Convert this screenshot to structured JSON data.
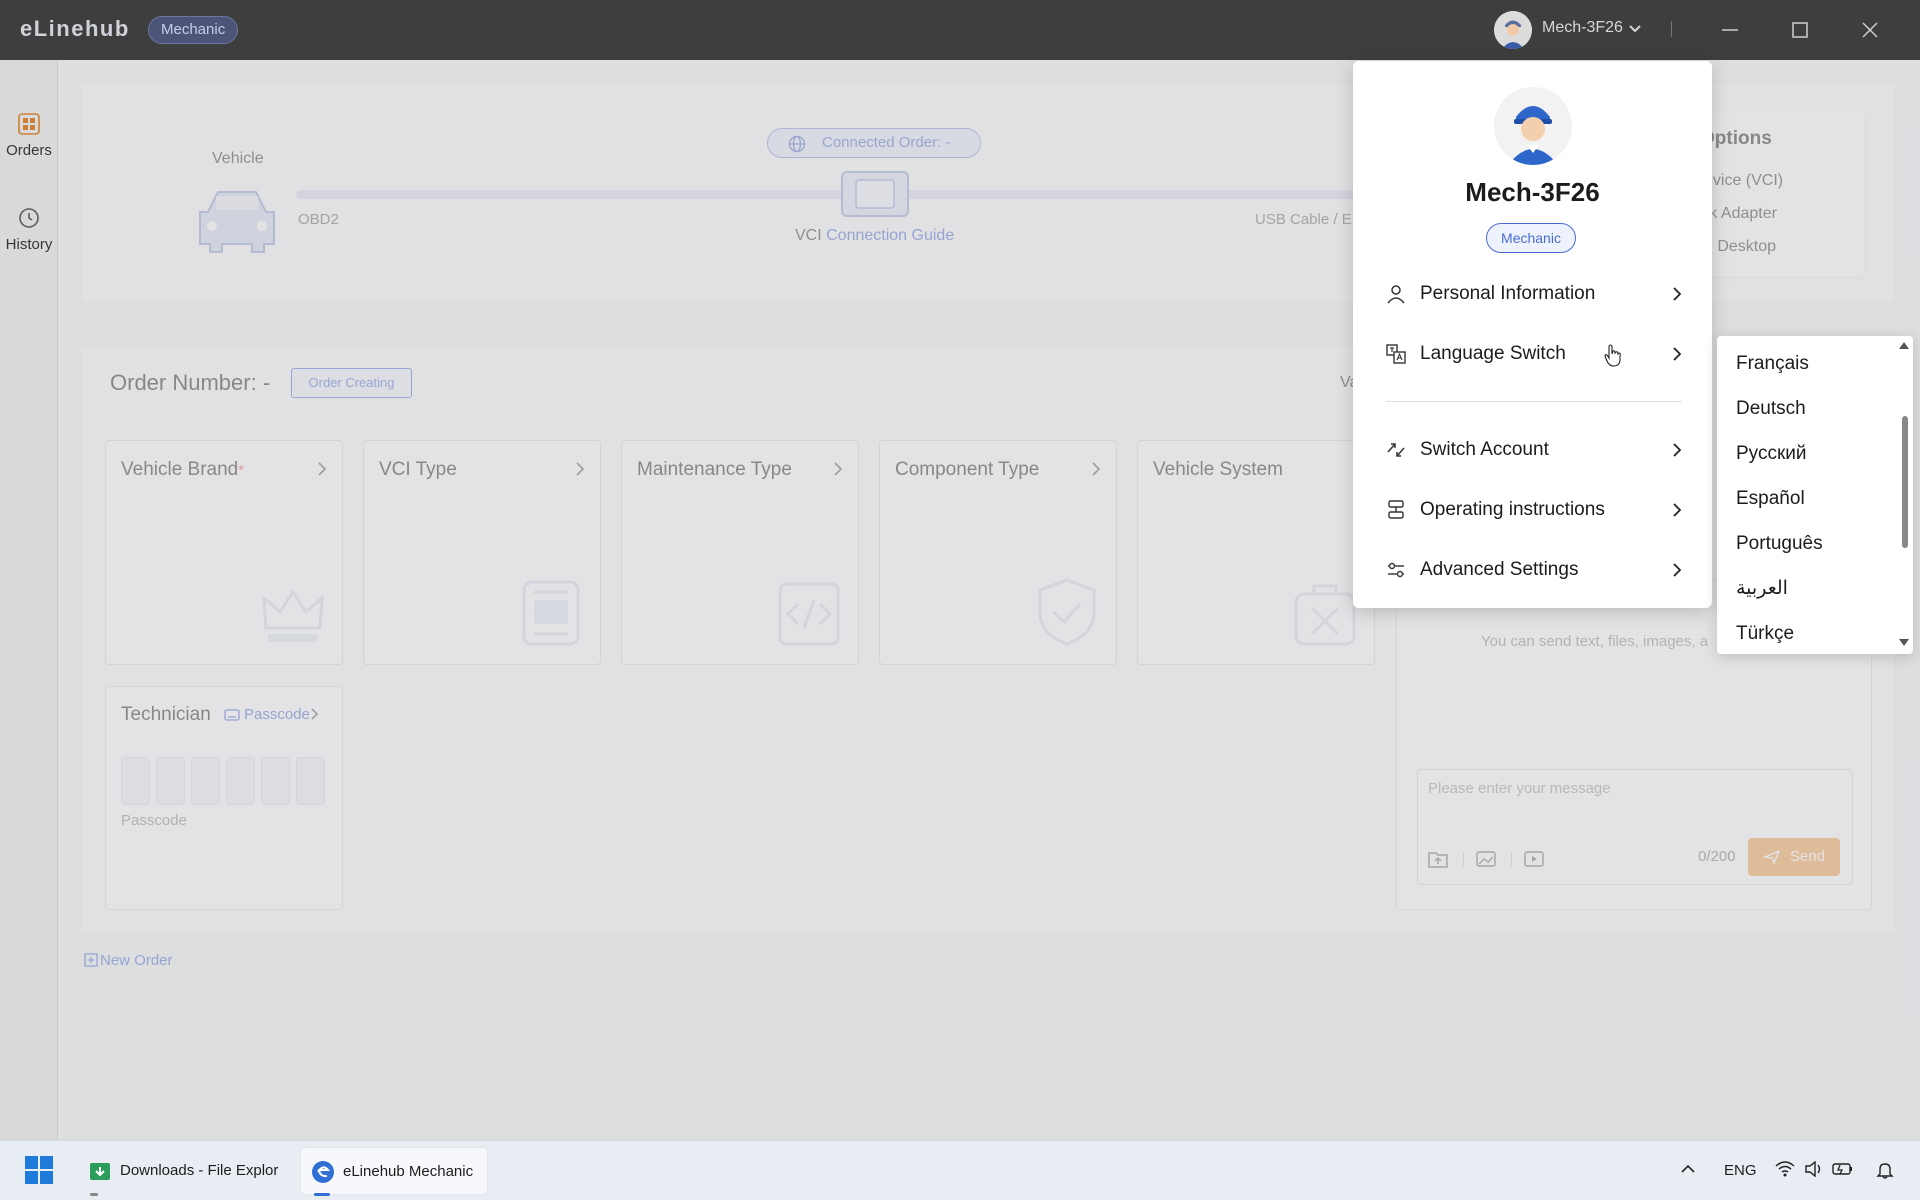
{
  "app": {
    "logo": "eLinehub",
    "role": "Mechanic",
    "user": "Mech-3F26"
  },
  "sidebar": {
    "items": [
      {
        "label": "Orders",
        "icon": "grid-icon"
      },
      {
        "label": "History",
        "icon": "clock-icon"
      }
    ]
  },
  "connection": {
    "vehicle_label": "Vehicle",
    "obd_label": "OBD2",
    "connected_order": "Connected Order: -",
    "vci_prefix": "VCI",
    "vci_link": "Connection Guide",
    "usb_label": "USB Cable / E"
  },
  "options": {
    "title": "Options",
    "items": [
      "evice (VCI)",
      "rk Adapter",
      "e Desktop"
    ]
  },
  "order": {
    "number_label": "Order Number: -",
    "status_badge": "Order Creating",
    "va_label": "Va",
    "cards": [
      {
        "title": "Vehicle Brand",
        "required": "*"
      },
      {
        "title": "VCI Type"
      },
      {
        "title": "Maintenance Type"
      },
      {
        "title": "Component Type"
      },
      {
        "title": "Vehicle System"
      }
    ],
    "technician": {
      "title": "Technician",
      "passcode_link": "Passcode",
      "passcode_hint": "Passcode"
    },
    "new_order": "New Order"
  },
  "chat": {
    "hint": "You can send text, files, images, a",
    "placeholder": "Please enter your message",
    "counter": "0/200",
    "send_label": "Send"
  },
  "profile_menu": {
    "name": "Mech-3F26",
    "badge": "Mechanic",
    "items": [
      {
        "label": "Personal Information",
        "icon": "user-icon"
      },
      {
        "label": "Language Switch",
        "icon": "translate-icon"
      },
      {
        "label": "Switch Account",
        "icon": "switch-icon"
      },
      {
        "label": "Operating instructions",
        "icon": "instructions-icon"
      },
      {
        "label": "Advanced Settings",
        "icon": "settings-sliders-icon"
      }
    ]
  },
  "languages": [
    "Français",
    "Deutsch",
    "Русский",
    "Español",
    "Português",
    "العربية",
    "Türkçe"
  ],
  "taskbar": {
    "apps": [
      {
        "label": "Downloads - File Explor"
      },
      {
        "label": "eLinehub Mechanic"
      }
    ],
    "lang": "ENG"
  },
  "colors": {
    "accent": "#4467d1",
    "send_button": "#f2a04b",
    "titlebar": "#3e3e3e"
  }
}
